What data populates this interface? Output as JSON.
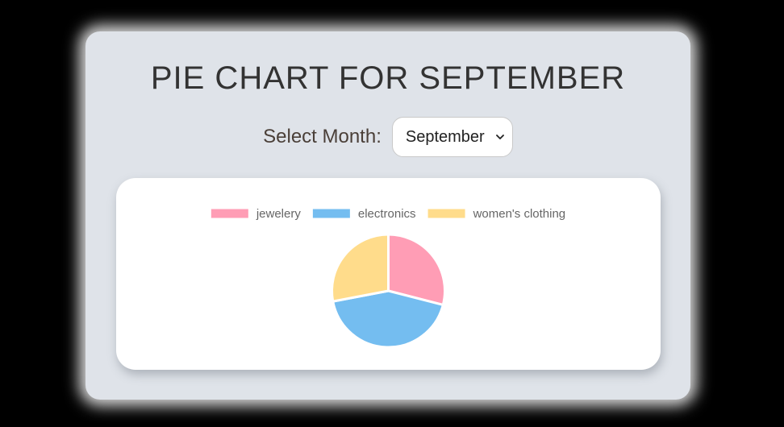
{
  "title": "PIE CHART FOR SEPTEMBER",
  "month_selector": {
    "label": "Select Month:",
    "selected": "September"
  },
  "chart_data": {
    "type": "pie",
    "title": "",
    "legend_position": "top",
    "categories": [
      "jewelery",
      "electronics",
      "women's clothing"
    ],
    "values": [
      29,
      43,
      28
    ],
    "colors": [
      "#ff9db5",
      "#74bdf0",
      "#ffdc8b"
    ]
  }
}
